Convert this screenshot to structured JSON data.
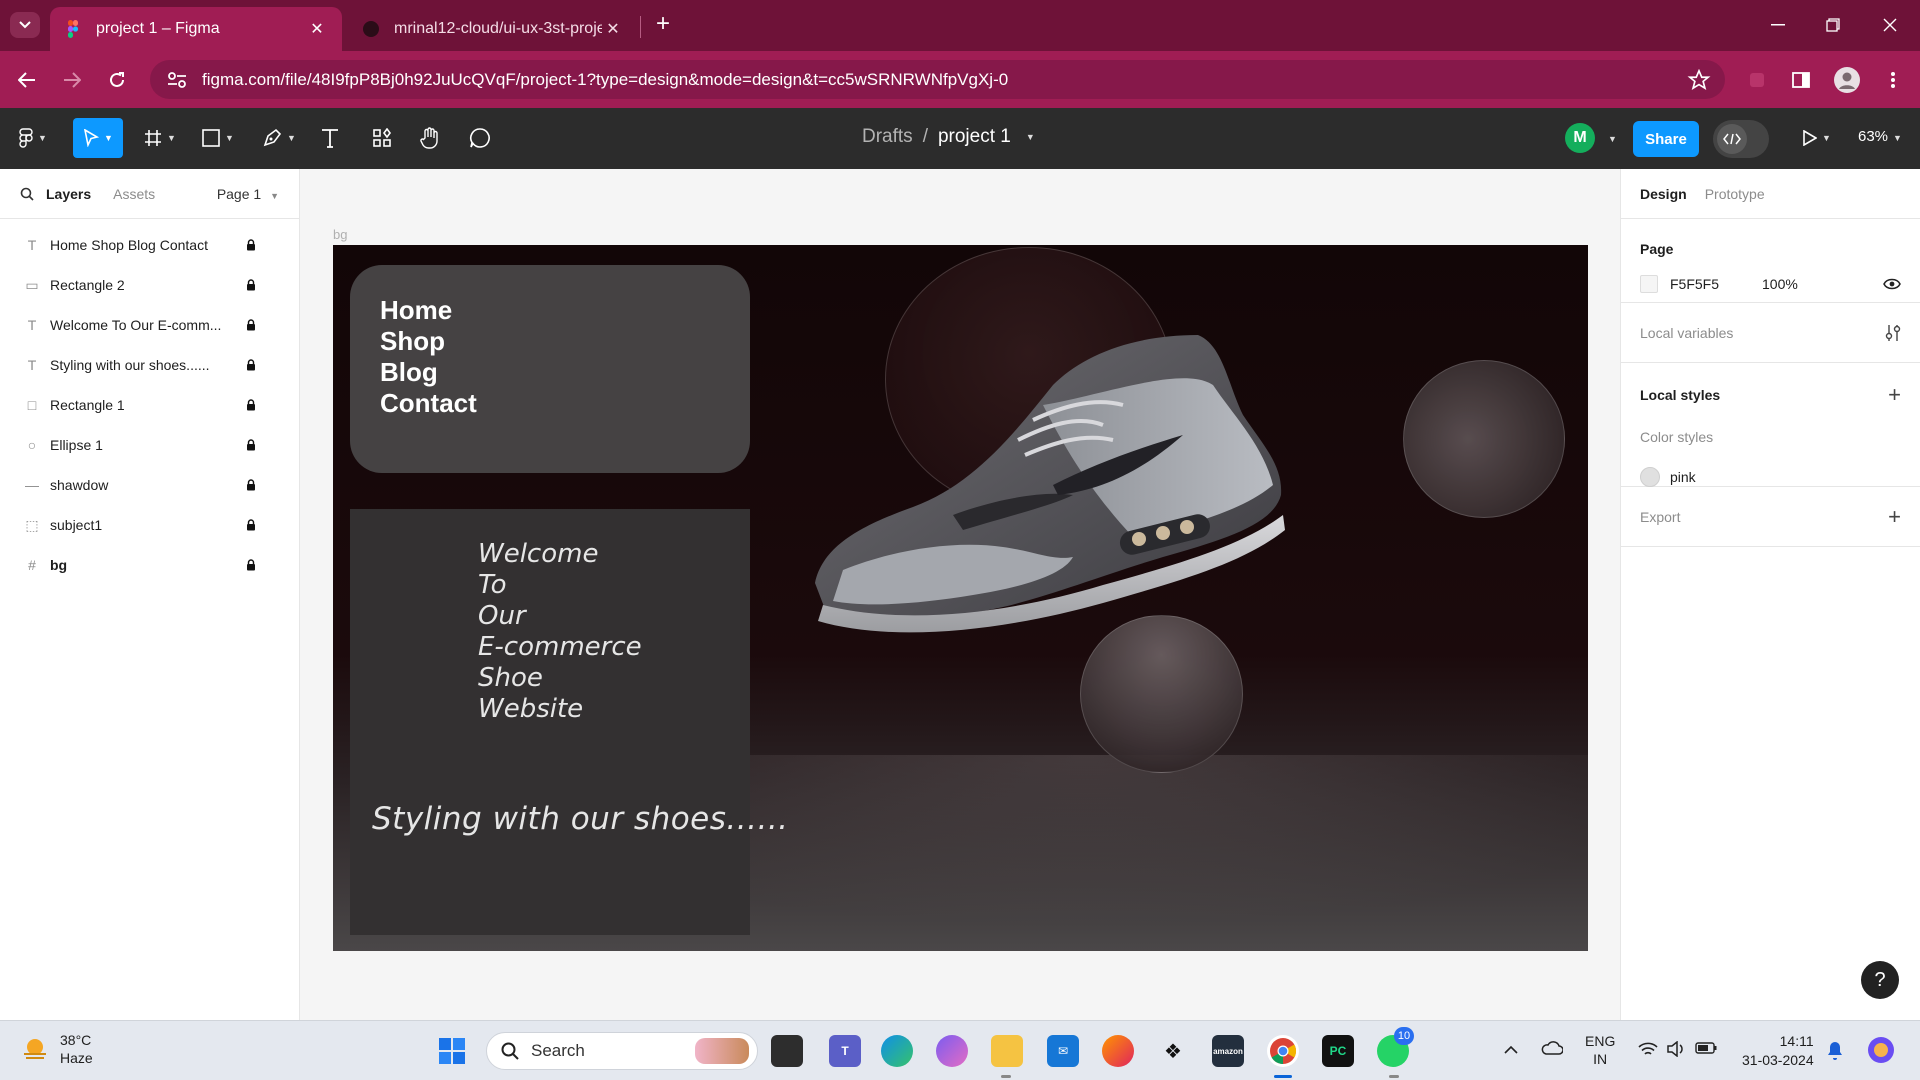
{
  "browser": {
    "tabs": [
      {
        "title": "project 1 – Figma",
        "active": true
      },
      {
        "title": "mrinal12-cloud/ui-ux-3st-proje",
        "active": false
      }
    ],
    "url": "figma.com/file/48I9fpP8Bj0h92JuUcQVqF/project-1?type=design&mode=design&t=cc5wSRNRWNfpVgXj-0"
  },
  "toolbar": {
    "breadcrumb_parent": "Drafts",
    "breadcrumb_sep": "/",
    "file_name": "project 1",
    "user_initial": "M",
    "share_label": "Share",
    "zoom": "63%"
  },
  "left_panel": {
    "tabs": {
      "layers": "Layers",
      "assets": "Assets"
    },
    "page": "Page 1",
    "layers": [
      {
        "name": "Home Shop Blog Contact",
        "icon": "T"
      },
      {
        "name": "Rectangle 2",
        "icon": "▭"
      },
      {
        "name": "Welcome To Our E-comm...",
        "icon": "T"
      },
      {
        "name": "Styling with our shoes......",
        "icon": "T"
      },
      {
        "name": "Rectangle 1",
        "icon": "□"
      },
      {
        "name": "Ellipse 1",
        "icon": "○"
      },
      {
        "name": "shawdow",
        "icon": "—"
      },
      {
        "name": "subject1",
        "icon": "⬚"
      },
      {
        "name": "bg",
        "icon": "#"
      }
    ]
  },
  "canvas": {
    "frame_label": "bg",
    "nav_items": [
      "Home",
      "Shop",
      "Blog",
      "Contact"
    ],
    "welcome_lines": [
      "Welcome",
      "To",
      "Our",
      "E-commerce",
      "Shoe",
      "Website"
    ],
    "tagline": "Styling with our shoes......"
  },
  "right_panel": {
    "tabs": {
      "design": "Design",
      "prototype": "Prototype"
    },
    "page_title": "Page",
    "page_color": "F5F5F5",
    "page_opacity": "100%",
    "local_variables": "Local variables",
    "local_styles": "Local styles",
    "color_styles": "Color styles",
    "style_name": "pink",
    "export": "Export",
    "help": "?"
  },
  "taskbar": {
    "temperature": "38°C",
    "weather": "Haze",
    "search_placeholder": "Search",
    "lang1": "ENG",
    "lang2": "IN",
    "time": "14:11",
    "date": "31-03-2024",
    "whatsapp_badge": "10",
    "amazon_label": "amazon",
    "pycharm_label": "PC"
  },
  "colors": {
    "browser_accent": "#a01d54",
    "figma_blue": "#0d99ff",
    "frame_bg": "#120607"
  }
}
